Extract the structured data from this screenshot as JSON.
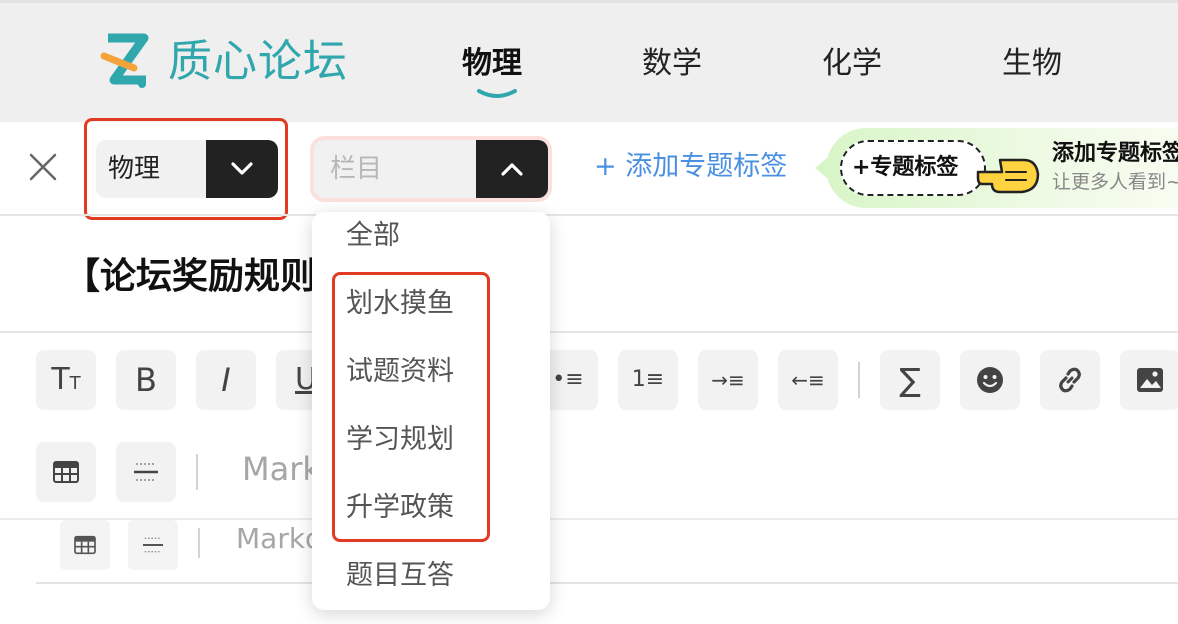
{
  "header": {
    "brand": "质心论坛",
    "nav": [
      {
        "label": "物理",
        "active": true
      },
      {
        "label": "数学",
        "active": false
      },
      {
        "label": "化学",
        "active": false
      },
      {
        "label": "生物",
        "active": false
      }
    ]
  },
  "toolbar": {
    "subject_select": {
      "value": "物理"
    },
    "column_select": {
      "placeholder": "栏目",
      "expanded": true
    },
    "add_tag_label": "+ 添加专题标签",
    "promo": {
      "chip_label": "+专题标签",
      "title": "添加专题标签",
      "subtitle": "让更多人看到~"
    }
  },
  "post": {
    "title": "【论坛奖励规则"
  },
  "editor": {
    "markdown_label": "Markdown",
    "tools": [
      {
        "name": "font-size",
        "glyph": "TT"
      },
      {
        "name": "bold",
        "glyph": "B"
      },
      {
        "name": "italic",
        "glyph": "I"
      },
      {
        "name": "underline",
        "glyph": "U"
      },
      {
        "name": "bullet-list",
        "glyph": "•≡"
      },
      {
        "name": "ordered-list",
        "glyph": "1≡"
      },
      {
        "name": "indent",
        "glyph": "→≡"
      },
      {
        "name": "outdent",
        "glyph": "←≡"
      },
      {
        "name": "formula",
        "glyph": "∑"
      },
      {
        "name": "emoji",
        "glyph": "☻"
      },
      {
        "name": "link",
        "glyph": "🔗"
      },
      {
        "name": "image",
        "glyph": "▣"
      },
      {
        "name": "table",
        "glyph": "▦"
      },
      {
        "name": "divider",
        "glyph": "⊟"
      }
    ]
  },
  "dropdown": {
    "items": [
      "全部",
      "划水摸鱼",
      "试题资料",
      "学习规划",
      "升学政策",
      "题目互答"
    ]
  },
  "colors": {
    "brand": "#2fa7ad",
    "highlight": "#e23b24",
    "link": "#4a90e2",
    "dark": "#222222"
  }
}
